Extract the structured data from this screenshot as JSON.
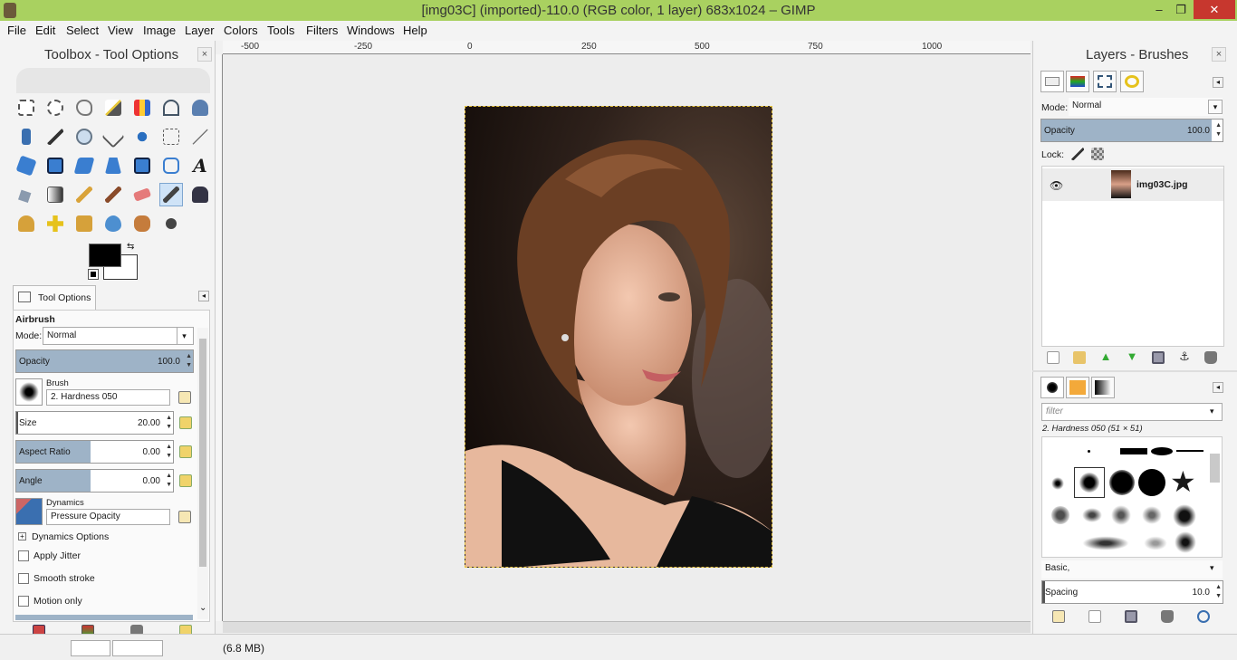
{
  "window": {
    "title": "[img03C] (imported)-110.0 (RGB color, 1 layer) 683x1024 – GIMP",
    "min": "–",
    "max": "❐",
    "close": "✕"
  },
  "menu": [
    "File",
    "Edit",
    "Select",
    "View",
    "Image",
    "Layer",
    "Colors",
    "Tools",
    "Filters",
    "Windows",
    "Help"
  ],
  "toolbox": {
    "title": "Toolbox - Tool Options",
    "close": "×"
  },
  "tool_options": {
    "tab_label": "Tool Options",
    "tool_name": "Airbrush",
    "mode_label": "Mode:",
    "mode_value": "Normal",
    "opacity_label": "Opacity",
    "opacity_value": "100.0",
    "opacity_fraction": 1.0,
    "brush_label": "Brush",
    "brush_value": "2. Hardness 050",
    "size_label": "Size",
    "size_value": "20.00",
    "aspect_label": "Aspect Ratio",
    "aspect_value": "0.00",
    "angle_label": "Angle",
    "angle_value": "0.00",
    "dynamics_label": "Dynamics",
    "dynamics_value": "Pressure Opacity",
    "dynamics_options": "Dynamics Options",
    "apply_jitter": "Apply Jitter",
    "smooth_stroke": "Smooth stroke",
    "motion_only": "Motion only"
  },
  "ruler": [
    "-500",
    "-250",
    "0",
    "250",
    "500",
    "750",
    "1000"
  ],
  "status": {
    "text": "(6.8 MB)"
  },
  "layers": {
    "title": "Layers - Brushes",
    "close": "×",
    "mode_label": "Mode:",
    "mode_value": "Normal",
    "opacity_label": "Opacity",
    "opacity_value": "100.0",
    "lock_label": "Lock:",
    "layer_name": "img03C.jpg"
  },
  "brushes": {
    "filter_placeholder": "filter",
    "current": "2. Hardness 050 (51 × 51)",
    "tag_value": "Basic,",
    "spacing_label": "Spacing",
    "spacing_value": "10.0"
  },
  "colors": {
    "accent": "#a9d160",
    "bar_fill": "#9eb3c7"
  }
}
